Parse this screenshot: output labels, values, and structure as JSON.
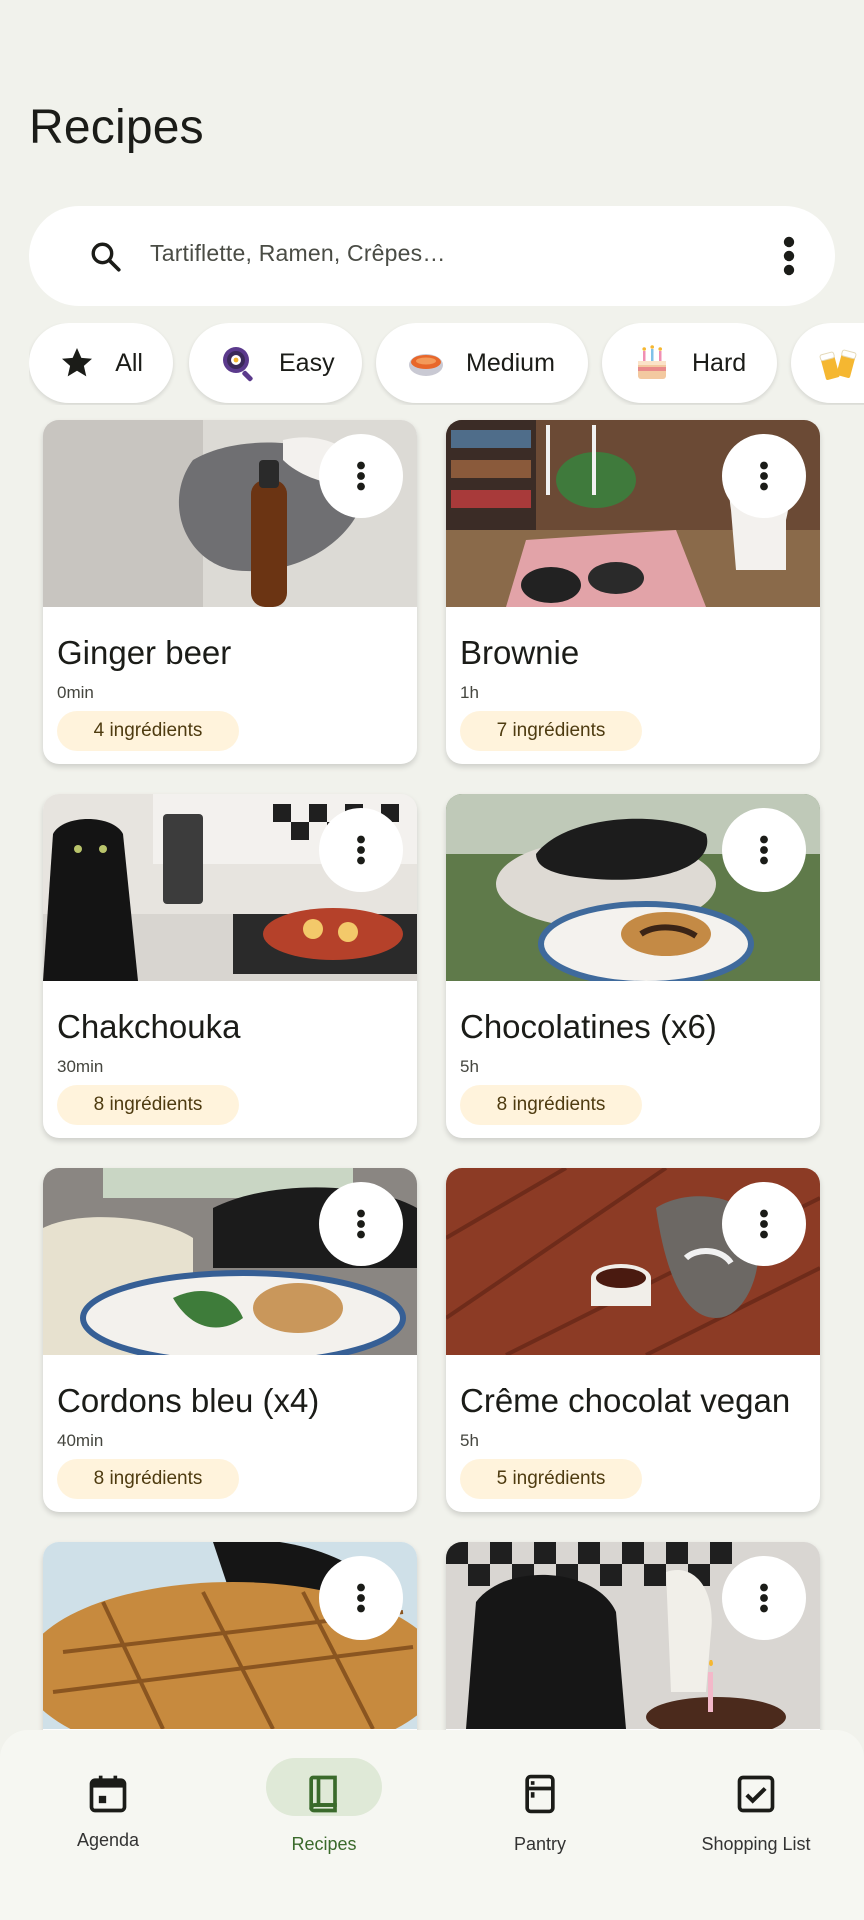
{
  "page": {
    "title": "Recipes"
  },
  "search": {
    "placeholder": "Tartiflette, Ramen, Crêpes…",
    "icon": "search-icon",
    "menu_icon": "more-vert-icon"
  },
  "filters": [
    {
      "label": "All",
      "icon": "star-icon",
      "selected": true
    },
    {
      "label": "Easy",
      "icon": "frying-pan-icon"
    },
    {
      "label": "Medium",
      "icon": "casserole-icon"
    },
    {
      "label": "Hard",
      "icon": "cake-icon"
    },
    {
      "label": "",
      "icon": "drinks-icon"
    }
  ],
  "recipes": [
    {
      "name": "Ginger beer",
      "time": "0min",
      "ingredients": "4 ingrédients",
      "image": "cat-with-bottle"
    },
    {
      "name": "Brownie",
      "time": "1h",
      "ingredients": "7 ingrédients",
      "image": "cat-by-bookshelf"
    },
    {
      "name": "Chakchouka",
      "time": "30min",
      "ingredients": "8 ingrédients",
      "image": "black-cat-kitchen"
    },
    {
      "name": "Chocolatines (x6)",
      "time": "5h",
      "ingredients": "8 ingrédients",
      "image": "cat-with-pastry"
    },
    {
      "name": "Cordons bleu (x4)",
      "time": "40min",
      "ingredients": "8 ingrédients",
      "image": "cat-with-plate"
    },
    {
      "name": "Crême chocolat vegan",
      "time": "5h",
      "ingredients": "5 ingrédients",
      "image": "kitten-on-tiles"
    },
    {
      "name": "",
      "time": "",
      "ingredients": "",
      "image": "cat-with-pie"
    },
    {
      "name": "",
      "time": "",
      "ingredients": "",
      "image": "cat-with-cake"
    }
  ],
  "nav": [
    {
      "label": "Agenda",
      "icon": "calendar-icon"
    },
    {
      "label": "Recipes",
      "icon": "book-icon",
      "active": true
    },
    {
      "label": "Pantry",
      "icon": "fridge-icon"
    },
    {
      "label": "Shopping List",
      "icon": "checkbox-icon"
    }
  ],
  "colors": {
    "background": "#f1f2ec",
    "badge": "#fff3dc",
    "active_pill": "#dfe9d7",
    "accent": "#3a6a2b"
  }
}
